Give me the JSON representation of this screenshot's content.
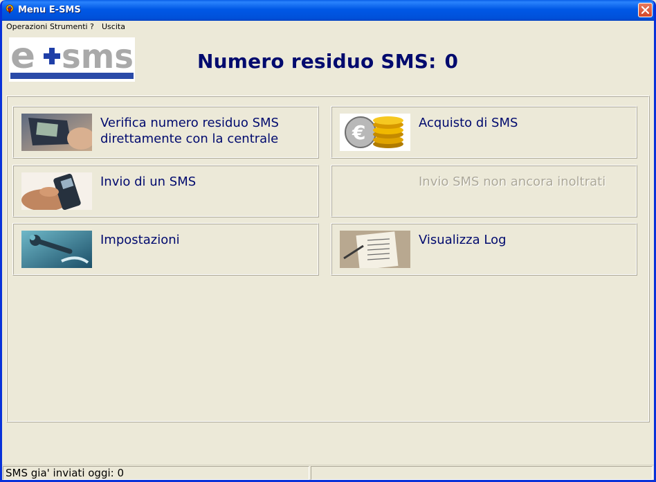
{
  "window": {
    "title": "Menu E-SMS"
  },
  "menu": [
    "Operazioni",
    "Strumenti",
    "?",
    "Uscita"
  ],
  "logo": {
    "text": "e+sms"
  },
  "header": {
    "label": "Numero residuo SMS:",
    "value": "0"
  },
  "tiles": [
    {
      "label": "Verifica numero residuo SMS direttamente con la centrale",
      "icon": "phone-photo-icon",
      "enabled": true
    },
    {
      "label": "Acquisto di SMS",
      "icon": "euro-coins-icon",
      "enabled": true
    },
    {
      "label": "Invio di un SMS",
      "icon": "hand-phone-icon",
      "enabled": true
    },
    {
      "label": "Invio SMS non ancora inoltrati",
      "icon": "",
      "enabled": false
    },
    {
      "label": "Impostazioni",
      "icon": "wrench-icon",
      "enabled": true
    },
    {
      "label": "Visualizza Log",
      "icon": "checklist-icon",
      "enabled": true
    }
  ],
  "status": {
    "sent_today": "SMS gia' inviati oggi: 0",
    "second": ""
  },
  "colors": {
    "title_blue": "#0058e6",
    "text_navy": "#000a6e",
    "face": "#ece9d8",
    "disabled": "#aca899"
  }
}
